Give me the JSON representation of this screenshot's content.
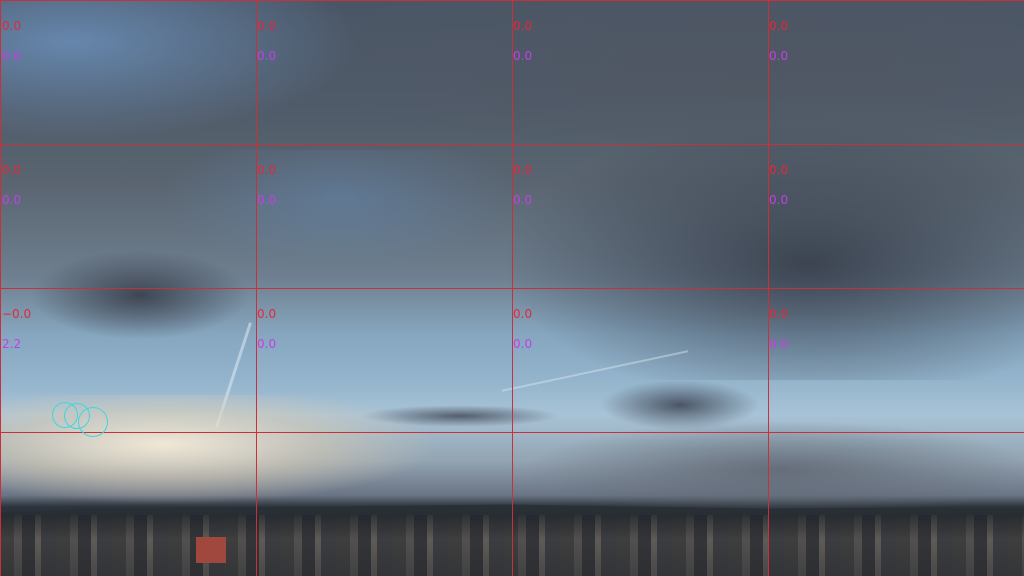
{
  "grid": {
    "line_color": "#c8303a",
    "rows": [
      {
        "cells": [
          {
            "value_a": "0.0",
            "value_b": "0.0"
          },
          {
            "value_a": "0.0",
            "value_b": "0.0"
          },
          {
            "value_a": "0.0",
            "value_b": "0.0"
          },
          {
            "value_a": "0.0",
            "value_b": "0.0"
          }
        ]
      },
      {
        "cells": [
          {
            "value_a": "0.0",
            "value_b": "0.0"
          },
          {
            "value_a": "0.0",
            "value_b": "0.0"
          },
          {
            "value_a": "0.0",
            "value_b": "0.0"
          },
          {
            "value_a": "0.0",
            "value_b": "0.0"
          }
        ]
      },
      {
        "cells": [
          {
            "value_a": "−0.0",
            "value_b": "2.2"
          },
          {
            "value_a": "0.0",
            "value_b": "0.0"
          },
          {
            "value_a": "0.0",
            "value_b": "0.0"
          },
          {
            "value_a": "0.0",
            "value_b": "0.0"
          }
        ]
      }
    ]
  },
  "colors": {
    "value_a": "#e3283a",
    "value_b": "#c040e8",
    "target_marker": "#3fd6e0"
  },
  "icons": {
    "target_markers": "cyan-circle-cluster-icon"
  }
}
